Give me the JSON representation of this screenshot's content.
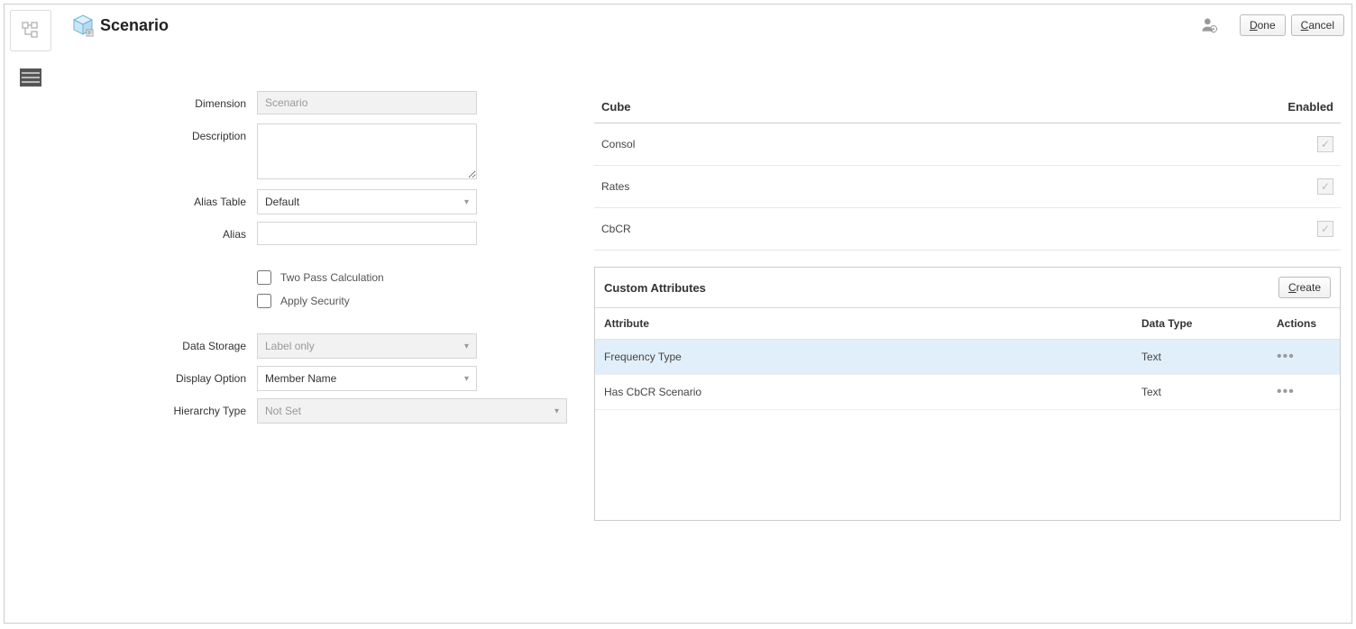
{
  "header": {
    "title": "Scenario",
    "done_label": "Done",
    "cancel_label": "Cancel"
  },
  "form": {
    "labels": {
      "dimension": "Dimension",
      "description": "Description",
      "alias_table": "Alias Table",
      "alias": "Alias",
      "two_pass": "Two Pass Calculation",
      "apply_security": "Apply Security",
      "data_storage": "Data Storage",
      "display_option": "Display Option",
      "hierarchy_type": "Hierarchy Type"
    },
    "values": {
      "dimension": "Scenario",
      "description": "",
      "alias_table": "Default",
      "alias": "",
      "two_pass": false,
      "apply_security": false,
      "data_storage": "Label only",
      "display_option": "Member Name",
      "hierarchy_type": "Not Set"
    }
  },
  "cubes": {
    "headers": {
      "cube": "Cube",
      "enabled": "Enabled"
    },
    "rows": [
      {
        "name": "Consol",
        "enabled": true
      },
      {
        "name": "Rates",
        "enabled": true
      },
      {
        "name": "CbCR",
        "enabled": true
      }
    ]
  },
  "custom_attributes": {
    "title": "Custom Attributes",
    "create_label": "Create",
    "headers": {
      "attribute": "Attribute",
      "data_type": "Data Type",
      "actions": "Actions"
    },
    "rows": [
      {
        "attribute": "Frequency Type",
        "data_type": "Text",
        "selected": true
      },
      {
        "attribute": "Has CbCR Scenario",
        "data_type": "Text",
        "selected": false
      }
    ]
  }
}
